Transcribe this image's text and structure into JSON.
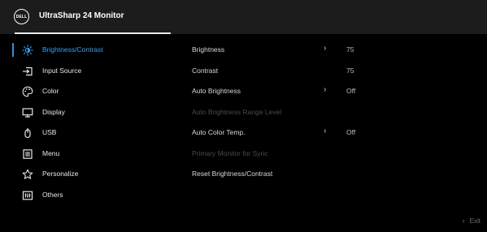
{
  "header": {
    "logo_text": "DELL",
    "title": "UltraSharp 24 Monitor"
  },
  "menu": {
    "items": [
      {
        "label": "Brightness/Contrast",
        "icon": "sun-icon",
        "active": true
      },
      {
        "label": "Input Source",
        "icon": "input-source-icon"
      },
      {
        "label": "Color",
        "icon": "palette-icon"
      },
      {
        "label": "Display",
        "icon": "display-icon"
      },
      {
        "label": "USB",
        "icon": "usb-icon"
      },
      {
        "label": "Menu",
        "icon": "menu-icon"
      },
      {
        "label": "Personalize",
        "icon": "star-icon"
      },
      {
        "label": "Others",
        "icon": "others-icon"
      }
    ]
  },
  "submenu": {
    "items": [
      {
        "label": "Brightness",
        "chevron": "›",
        "value": "75"
      },
      {
        "label": "Contrast",
        "chevron": "",
        "value": "75"
      },
      {
        "label": "Auto Brightness",
        "chevron": "›",
        "value": "Off"
      },
      {
        "label": "Auto Brightness Range Level",
        "chevron": "",
        "value": ""
      },
      {
        "label": "Auto Color Temp.",
        "chevron": "›",
        "value": "Off"
      },
      {
        "label": "Primary Monitor for Sync",
        "chevron": "",
        "value": ""
      },
      {
        "label": "Reset Brightness/Contrast",
        "chevron": "",
        "value": ""
      }
    ]
  },
  "footer": {
    "exit_chevron": "‹",
    "exit_label": "Exit"
  },
  "colors": {
    "accent": "#3aa0ef",
    "background": "#000000",
    "header": "#1c1c1c"
  }
}
